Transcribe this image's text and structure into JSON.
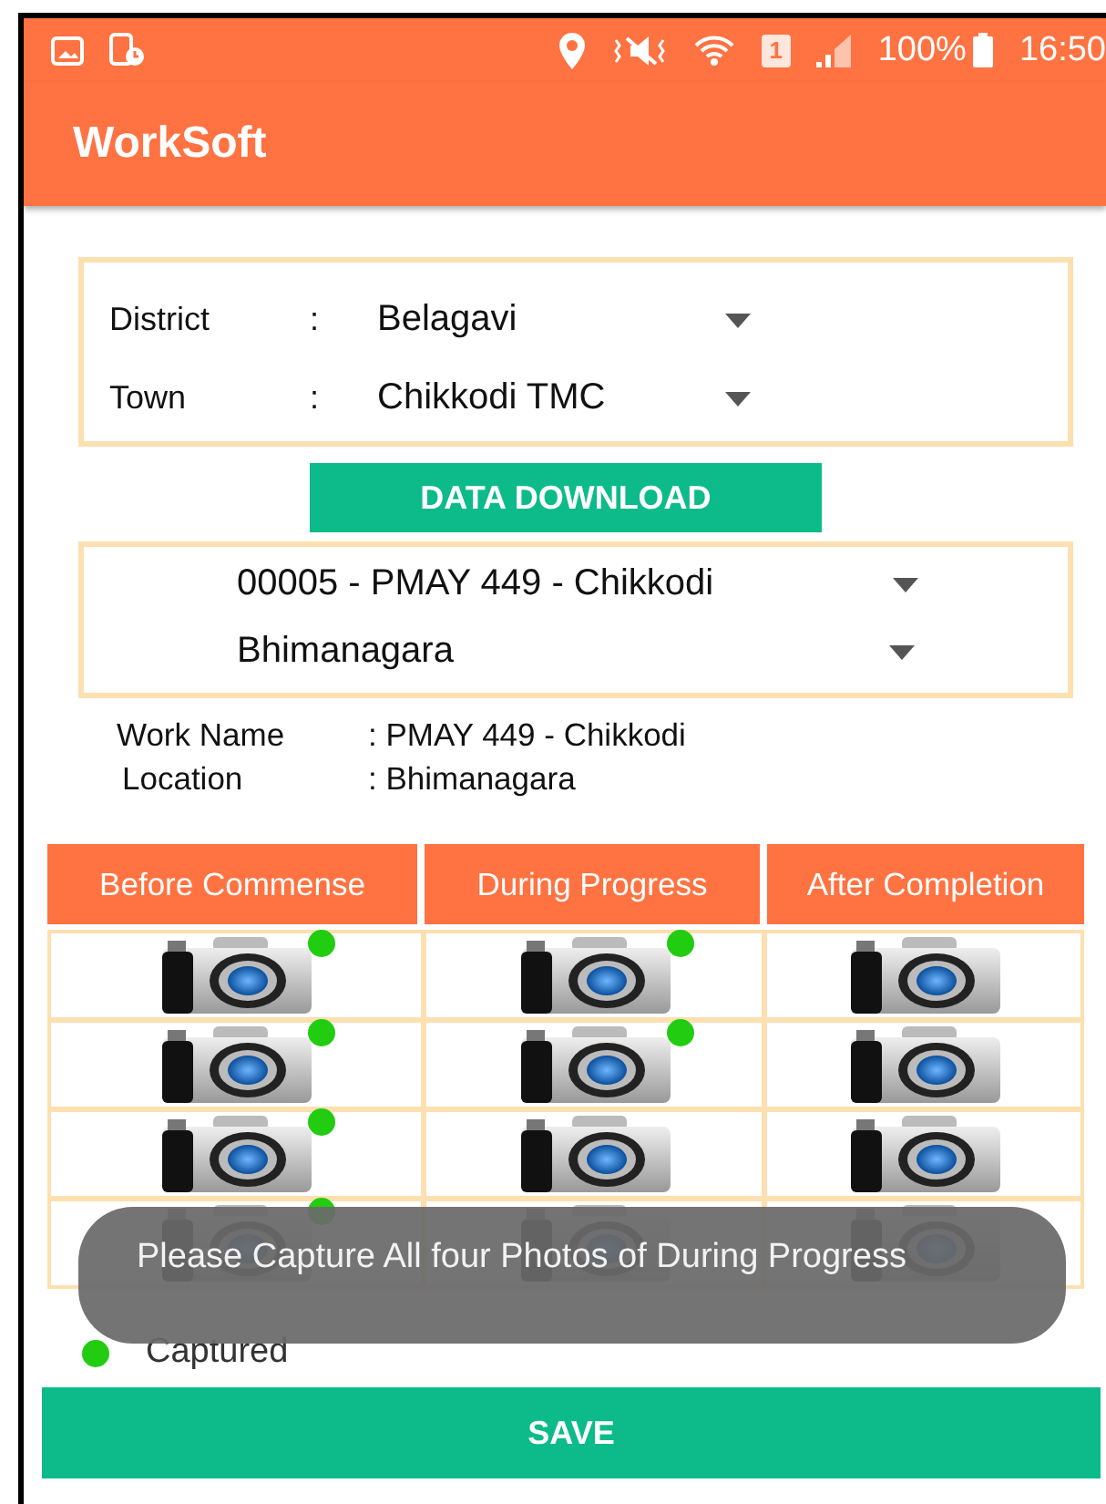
{
  "status_bar": {
    "sim_slot": "1",
    "battery": "100%",
    "time": "16:50"
  },
  "app_bar": {
    "title": "WorkSoft"
  },
  "location": [
    {
      "label": "District",
      "separator": ":",
      "value": "Belagavi"
    },
    {
      "label": "Town",
      "separator": ":",
      "value": "Chikkodi TMC"
    }
  ],
  "download_button": "DATA DOWNLOAD",
  "work_selectors": [
    {
      "value": "00005 - PMAY 449 - Chikkodi"
    },
    {
      "value": "Bhimanagara"
    }
  ],
  "work_info": [
    {
      "label": "Work Name",
      "value": ": PMAY 449 - Chikkodi"
    },
    {
      "label": "Location",
      "value": ": Bhimanagara"
    }
  ],
  "photo_table": {
    "columns": [
      "Before Commense",
      "During Progress",
      "After Completion"
    ],
    "rows": [
      {
        "cells": [
          {
            "captured": true
          },
          {
            "captured": true
          },
          {
            "captured": false
          }
        ]
      },
      {
        "cells": [
          {
            "captured": true
          },
          {
            "captured": true
          },
          {
            "captured": false
          }
        ]
      },
      {
        "cells": [
          {
            "captured": true
          },
          {
            "captured": false
          },
          {
            "captured": false
          }
        ]
      },
      {
        "cells": [
          {
            "captured": true
          },
          {
            "captured": false
          },
          {
            "captured": false
          }
        ]
      }
    ]
  },
  "legend": {
    "label": "Captured",
    "color": "#22cc11"
  },
  "save_button": "SAVE",
  "toast": "Please Capture All four Photos of During Progress"
}
